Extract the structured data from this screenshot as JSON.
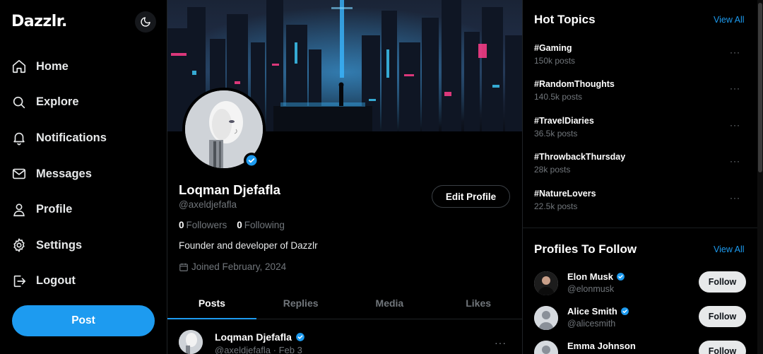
{
  "app": {
    "logo": "Dazzlr."
  },
  "sidebar": {
    "items": [
      {
        "label": "Home",
        "icon": "home-icon"
      },
      {
        "label": "Explore",
        "icon": "search-icon"
      },
      {
        "label": "Notifications",
        "icon": "bell-icon"
      },
      {
        "label": "Messages",
        "icon": "mail-icon"
      },
      {
        "label": "Profile",
        "icon": "user-icon"
      },
      {
        "label": "Settings",
        "icon": "gear-icon"
      },
      {
        "label": "Logout",
        "icon": "logout-icon"
      }
    ],
    "post_label": "Post",
    "theme_toggle_icon": "moon-icon"
  },
  "profile": {
    "name": "Loqman Djefafla",
    "handle": "@axeldjefafla",
    "edit_label": "Edit Profile",
    "followers_count": "0",
    "followers_label": "Followers",
    "following_count": "0",
    "following_label": "Following",
    "bio": "Founder and developer of Dazzlr",
    "joined": "Joined February, 2024",
    "tabs": [
      "Posts",
      "Replies",
      "Media",
      "Likes"
    ],
    "active_tab": "Posts"
  },
  "post_preview": {
    "name": "Loqman Djefafla",
    "handle": "@axeldjefafla",
    "separator": "·",
    "date": "Feb 3",
    "more": "···"
  },
  "hot_topics": {
    "title": "Hot Topics",
    "view_all": "View All",
    "items": [
      {
        "tag": "#Gaming",
        "count": "150k posts"
      },
      {
        "tag": "#RandomThoughts",
        "count": "140.5k posts"
      },
      {
        "tag": "#TravelDiaries",
        "count": "36.5k posts"
      },
      {
        "tag": "#ThrowbackThursday",
        "count": "28k posts"
      },
      {
        "tag": "#NatureLovers",
        "count": "22.5k posts"
      }
    ],
    "more": "···"
  },
  "profiles_to_follow": {
    "title": "Profiles To Follow",
    "view_all": "View All",
    "follow_label": "Follow",
    "items": [
      {
        "name": "Elon Musk",
        "handle": "@elonmusk",
        "verified": true
      },
      {
        "name": "Alice Smith",
        "handle": "@alicesmith",
        "verified": true
      },
      {
        "name": "Emma Johnson",
        "handle": "",
        "verified": false
      }
    ]
  },
  "colors": {
    "accent": "#1d9bf0",
    "background": "#000000",
    "muted_text": "#71767b"
  }
}
